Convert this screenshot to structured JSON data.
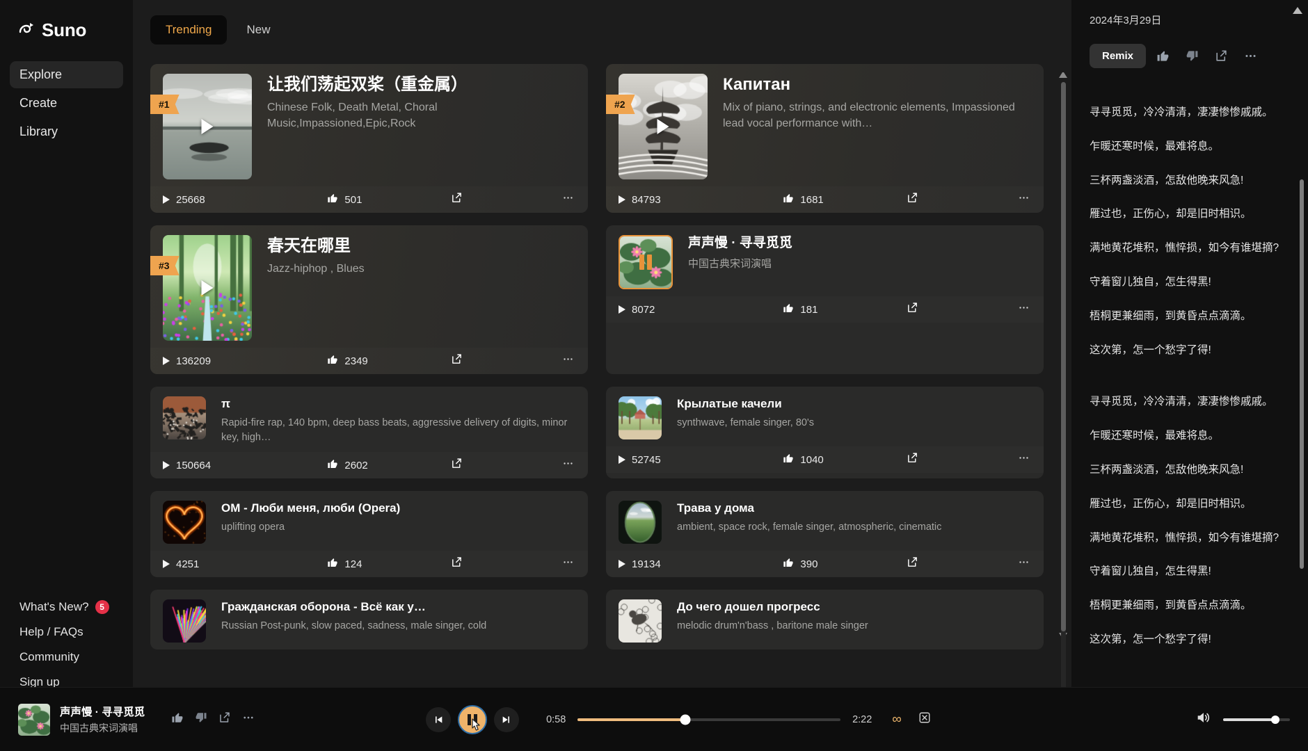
{
  "brand": {
    "name": "Suno",
    "logo_icon": "suno-logo-icon"
  },
  "sidebar": {
    "primary": [
      {
        "label": "Explore",
        "active": true
      },
      {
        "label": "Create",
        "active": false
      },
      {
        "label": "Library",
        "active": false
      }
    ],
    "secondary": [
      {
        "label": "What's New?",
        "badge": "5"
      },
      {
        "label": "Help / FAQs",
        "badge": ""
      },
      {
        "label": "Community",
        "badge": ""
      },
      {
        "label": "Sign up",
        "badge": ""
      }
    ]
  },
  "tabs": [
    {
      "label": "Trending",
      "active": true
    },
    {
      "label": "New",
      "active": false
    }
  ],
  "songs": [
    {
      "rank": "#1",
      "title": "让我们荡起双桨（重金属）",
      "subtitle": "Chinese Folk, Death Metal, Choral Music,Impassioned,Epic,Rock",
      "plays": "25668",
      "likes": "501",
      "size": "big",
      "art": "lake-boat-art",
      "state": "play"
    },
    {
      "rank": "#2",
      "title": "Капитан",
      "subtitle": "Mix of piano, strings, and electronic elements, Impassioned lead vocal performance with…",
      "plays": "84793",
      "likes": "1681",
      "size": "big",
      "art": "sailing-ship-art",
      "state": "play"
    },
    {
      "rank": "#3",
      "title": "春天在哪里",
      "subtitle": "Jazz-hiphop , Blues",
      "plays": "136209",
      "likes": "2349",
      "size": "big",
      "art": "forest-flowers-art",
      "state": "play"
    },
    {
      "rank": "",
      "title": "声声慢 · 寻寻觅觅",
      "subtitle": "中国古典宋词演唱",
      "plays": "8072",
      "likes": "181",
      "size": "mid",
      "art": "lotus-pond-art",
      "state": "pause"
    },
    {
      "rank": "",
      "title": "π",
      "subtitle": "Rapid-fire rap, 140 bpm, deep bass beats, aggressive delivery of digits, minor key, high…",
      "plays": "150664",
      "likes": "2602",
      "size": "sm",
      "art": "machinery-art",
      "state": "none"
    },
    {
      "rank": "",
      "title": "Крылатые качели",
      "subtitle": "synthwave, female singer, 80's",
      "plays": "52745",
      "likes": "1040",
      "size": "sm",
      "art": "park-swing-art",
      "state": "none"
    },
    {
      "rank": "",
      "title": "OM - Люби меня, люби (Opera)",
      "subtitle": "uplifting opera",
      "plays": "4251",
      "likes": "124",
      "size": "sm",
      "art": "fire-heart-art",
      "state": "none"
    },
    {
      "rank": "",
      "title": "Трава у дома",
      "subtitle": "ambient, space rock, female singer, atmospheric, cinematic",
      "plays": "19134",
      "likes": "390",
      "size": "sm",
      "art": "green-field-art",
      "state": "none"
    },
    {
      "rank": "",
      "title": "Гражданская оборона - Всё как у…",
      "subtitle": "Russian Post-punk, slow paced, sadness, male singer, cold",
      "plays": "",
      "likes": "",
      "size": "sm",
      "art": "colorful-feathers-art",
      "state": "none"
    },
    {
      "rank": "",
      "title": "До чего дошел прогресс",
      "subtitle": "melodic drum'n'bass , baritone male singer",
      "plays": "",
      "likes": "",
      "size": "sm",
      "art": "bird-engraving-art",
      "state": "none"
    }
  ],
  "lyrics_panel": {
    "date": "2024年3月29日",
    "remix_label": "Remix",
    "actions": [
      "thumbs-up-icon",
      "thumbs-down-icon",
      "share-icon",
      "more-icon"
    ],
    "verse_one": [
      "寻寻觅觅，冷冷清清，凄凄惨惨戚戚。",
      "乍暖还寒时候，最难将息。",
      "三杯两盏淡酒，怎敌他晚来风急!",
      "雁过也，正伤心，却是旧时相识。",
      "满地黄花堆积，憔悴损，如今有谁堪摘?",
      "守着窗儿独自，怎生得黑!",
      "梧桐更兼细雨，到黄昏点点滴滴。",
      "这次第，怎一个愁字了得!"
    ],
    "verse_two": [
      "寻寻觅觅，冷冷清清，凄凄惨惨戚戚。",
      "乍暖还寒时候，最难将息。",
      "三杯两盏淡酒，怎敌他晚来风急!",
      "雁过也，正伤心，却是旧时相识。",
      "满地黄花堆积，憔悴损，如今有谁堪摘?",
      "守着窗儿独自，怎生得黑!",
      "梧桐更兼细雨，到黄昏点点滴滴。",
      "这次第，怎一个愁字了得!"
    ]
  },
  "player": {
    "track_title": "声声慢 · 寻寻觅觅",
    "track_subtitle": "中国古典宋词演唱",
    "current_time": "0:58",
    "total_time": "2:22",
    "progress_percent": 41,
    "volume_percent": 78,
    "state": "playing",
    "icons": {
      "like": "thumbs-up-icon",
      "dislike": "thumbs-down-icon",
      "share": "share-icon",
      "more": "more-icon",
      "prev": "skip-back-icon",
      "play_pause": "pause-icon",
      "next": "skip-forward-icon",
      "loop": "infinity-icon",
      "shuffle": "shuffle-icon",
      "volume": "speaker-icon"
    }
  },
  "colors": {
    "accent": "#efa44f",
    "accent_soft": "#efbc7e",
    "badge": "#e53148",
    "bg": "#1c1c1c",
    "sidebar_bg": "#121212",
    "card_bg": "#2a2a29"
  }
}
